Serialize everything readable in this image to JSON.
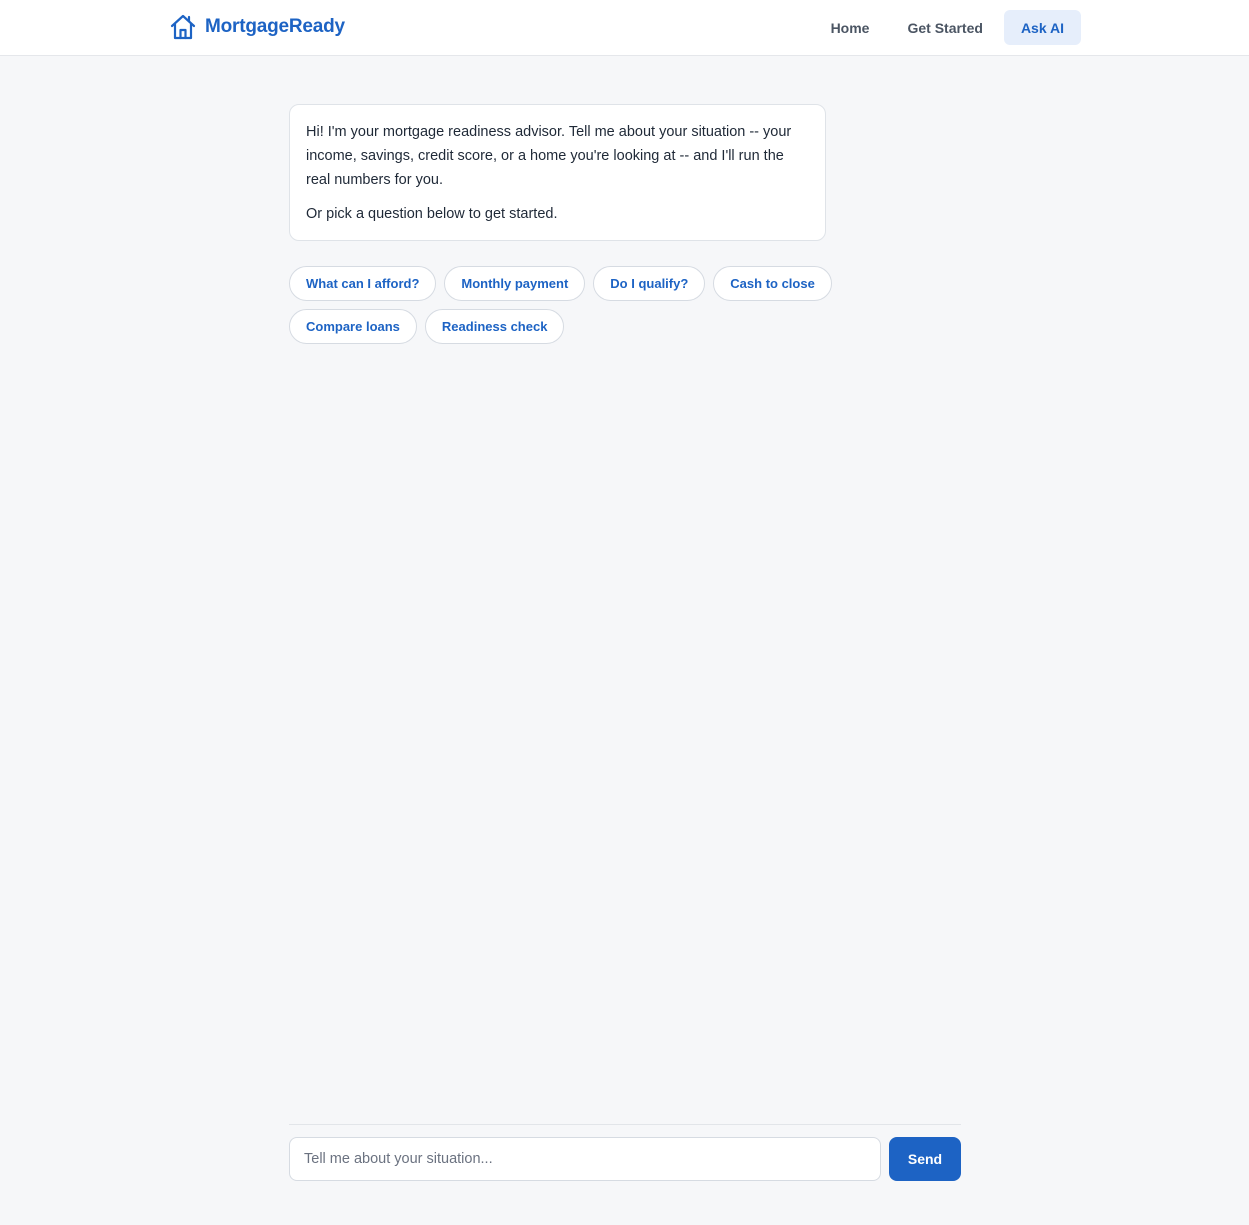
{
  "app": {
    "brand": "MortgageReady",
    "logo_icon": "house-icon",
    "accent_color": "#1d63c4"
  },
  "nav": {
    "items": [
      {
        "label": "Home",
        "active": false
      },
      {
        "label": "Get Started",
        "active": false
      },
      {
        "label": "Ask AI",
        "active": true
      }
    ]
  },
  "chat": {
    "welcome_paragraphs": [
      "Hi! I'm your mortgage readiness advisor. Tell me about your situation -- your income, savings, credit score, or a home you're looking at -- and I'll run the real numbers for you.",
      "Or pick a question below to get started."
    ],
    "suggestions": [
      "What can I afford?",
      "Monthly payment",
      "Do I qualify?",
      "Cash to close",
      "Compare loans",
      "Readiness check"
    ]
  },
  "composer": {
    "value": "",
    "placeholder": "Tell me about your situation...",
    "send_label": "Send"
  }
}
